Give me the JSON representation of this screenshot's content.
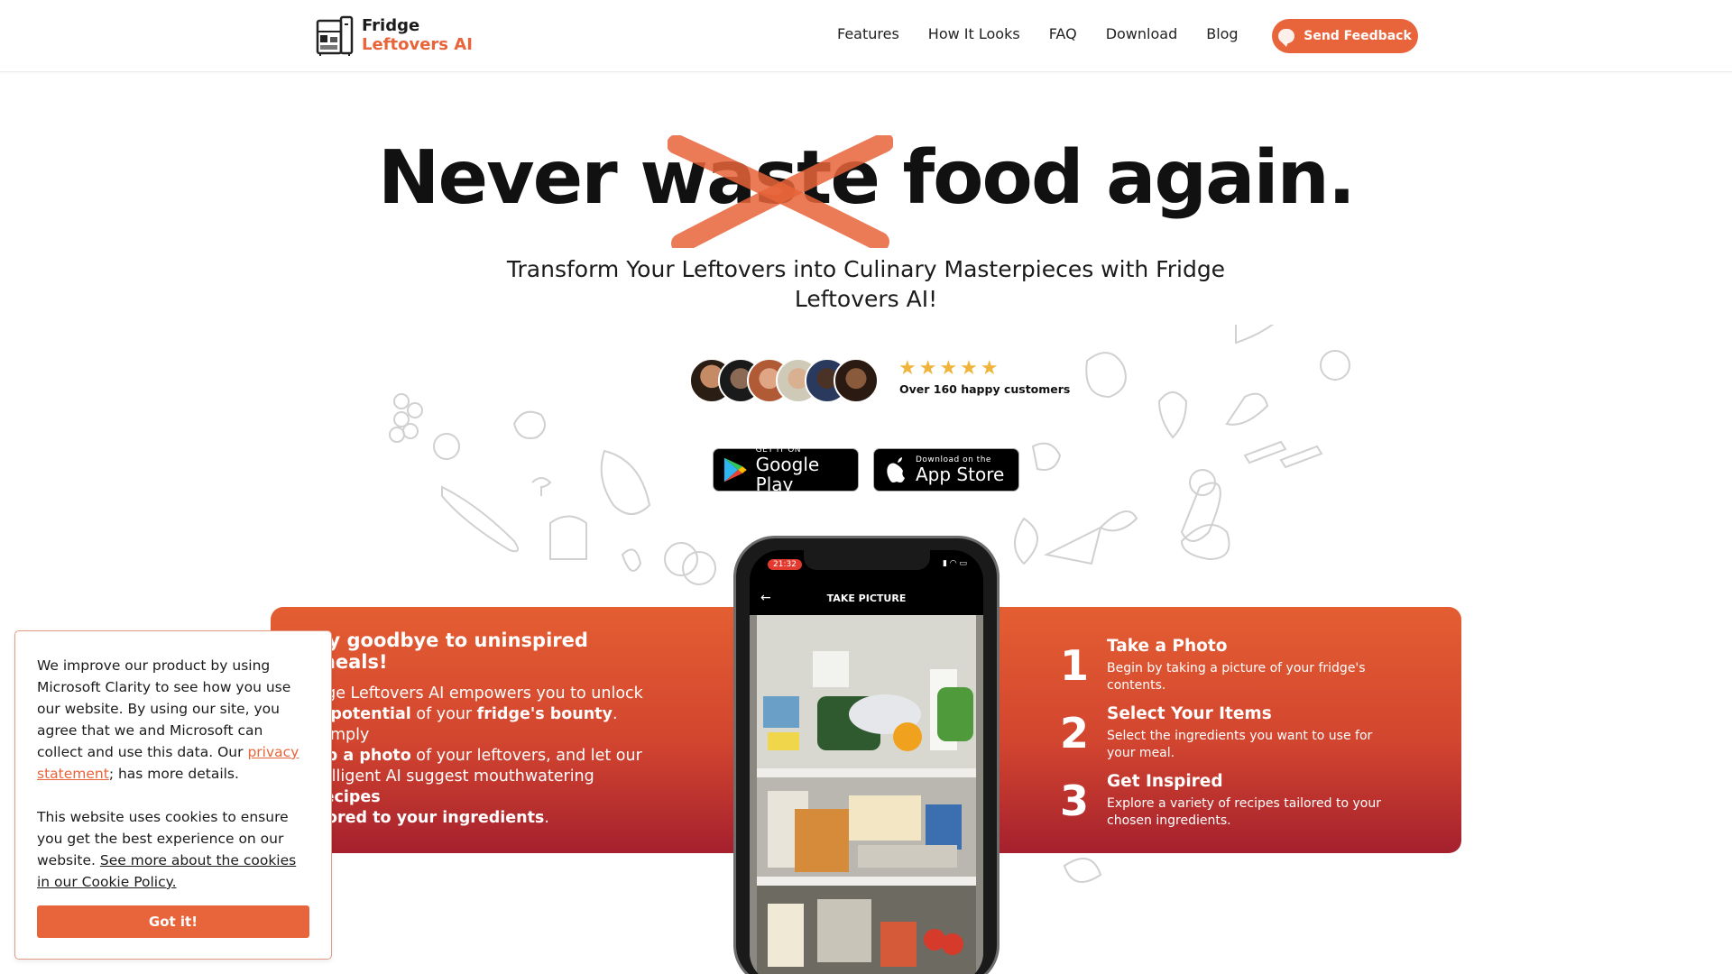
{
  "nav": {
    "logo_line1": "Fridge",
    "logo_line2": "Leftovers AI",
    "links": [
      "Features",
      "How It Looks",
      "FAQ",
      "Download",
      "Blog"
    ],
    "feedback_label": "Send Feedback"
  },
  "hero": {
    "title_pre": "Never ",
    "title_strike": "waste",
    "title_post": " food again.",
    "subtitle": "Transform Your Leftovers into Culinary Masterpieces with Fridge Leftovers AI!",
    "stars": "★★★★★",
    "social_proof": "Over 160 happy customers",
    "google_small": "GET IT ON",
    "google_big": "Google Play",
    "apple_small": "Download on the",
    "apple_big": "App Store"
  },
  "band": {
    "heading": "ay goodbye to uninspired meals!",
    "p_parts": [
      "dge Leftovers AI empowers you to unlock",
      "e ",
      "potential",
      " of your ",
      "fridge's bounty",
      ". Simply",
      "ap a photo",
      " of your leftovers, and let our",
      "telligent AI suggest mouthwatering ",
      "recipes",
      "ilored to your ingredients",
      "."
    ],
    "steps": [
      {
        "num": "1",
        "title": "Take a Photo",
        "desc": "Begin by taking a picture of your fridge's contents."
      },
      {
        "num": "2",
        "title": "Select Your Items",
        "desc": "Select the ingredients you want to use for your meal."
      },
      {
        "num": "3",
        "title": "Get Inspired",
        "desc": "Explore a variety of recipes tailored to your chosen ingredients."
      }
    ]
  },
  "phone": {
    "time": "21:32",
    "appbar_title": "TAKE PICTURE",
    "back_icon": "←"
  },
  "cookie": {
    "p1_a": "We improve our product by using Microsoft Clarity to see how you use our website. By using our site, you agree that we and Microsoft can collect and use this data. Our ",
    "p1_link": "privacy statement",
    "p1_b": "; has more details.",
    "p2_a": "This website uses cookies to ensure you get the best experience on our website. ",
    "p2_link": "See more about the cookies in our Cookie Policy.",
    "button": "Got it!"
  },
  "colors": {
    "accent": "#e8643a",
    "band_top": "#e45e32",
    "band_bottom": "#a5202e",
    "star": "#f1b43a"
  }
}
